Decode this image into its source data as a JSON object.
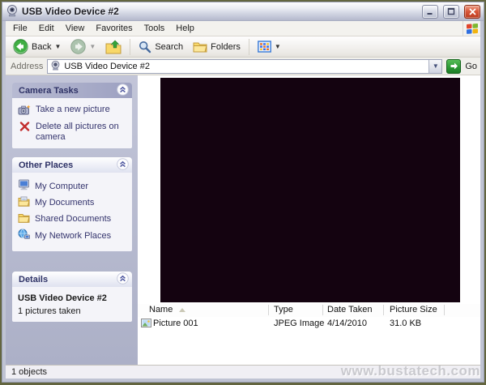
{
  "window": {
    "title": "USB Video Device #2",
    "controls": {
      "minimize": "minimize",
      "maximize": "maximize",
      "close": "close"
    }
  },
  "menu": {
    "items": [
      "File",
      "Edit",
      "View",
      "Favorites",
      "Tools",
      "Help"
    ]
  },
  "toolbar": {
    "back_label": "Back",
    "search_label": "Search",
    "folders_label": "Folders"
  },
  "address_bar": {
    "label": "Address",
    "value": "USB Video Device #2",
    "go_label": "Go"
  },
  "sidebar": {
    "camera_tasks": {
      "title": "Camera Tasks",
      "items": [
        {
          "label": "Take a new picture",
          "icon": "camera-icon"
        },
        {
          "label": "Delete all pictures on camera",
          "icon": "delete-x-icon"
        }
      ]
    },
    "other_places": {
      "title": "Other Places",
      "items": [
        {
          "label": "My Computer",
          "icon": "computer-icon"
        },
        {
          "label": "My Documents",
          "icon": "documents-folder-icon"
        },
        {
          "label": "Shared Documents",
          "icon": "shared-folder-icon"
        },
        {
          "label": "My Network Places",
          "icon": "network-places-icon"
        }
      ]
    },
    "details": {
      "title": "Details",
      "name": "USB Video Device #2",
      "info": "1 pictures taken"
    }
  },
  "file_list": {
    "columns": [
      "Name",
      "Type",
      "Date Taken",
      "Picture Size"
    ],
    "rows": [
      {
        "name": "Picture 001",
        "type": "JPEG Image",
        "date_taken": "4/14/2010",
        "picture_size": "31.0 KB"
      }
    ]
  },
  "status_bar": {
    "text": "1 objects"
  },
  "watermark": "www.bustatech.com",
  "colors": {
    "accent_green": "#2a9733",
    "close_red": "#bc3a1e",
    "sidebar_bg": "#b4b8cd",
    "panel_header_text": "#2e3266",
    "preview_black": "#140310",
    "border_olive": "#63653f"
  }
}
